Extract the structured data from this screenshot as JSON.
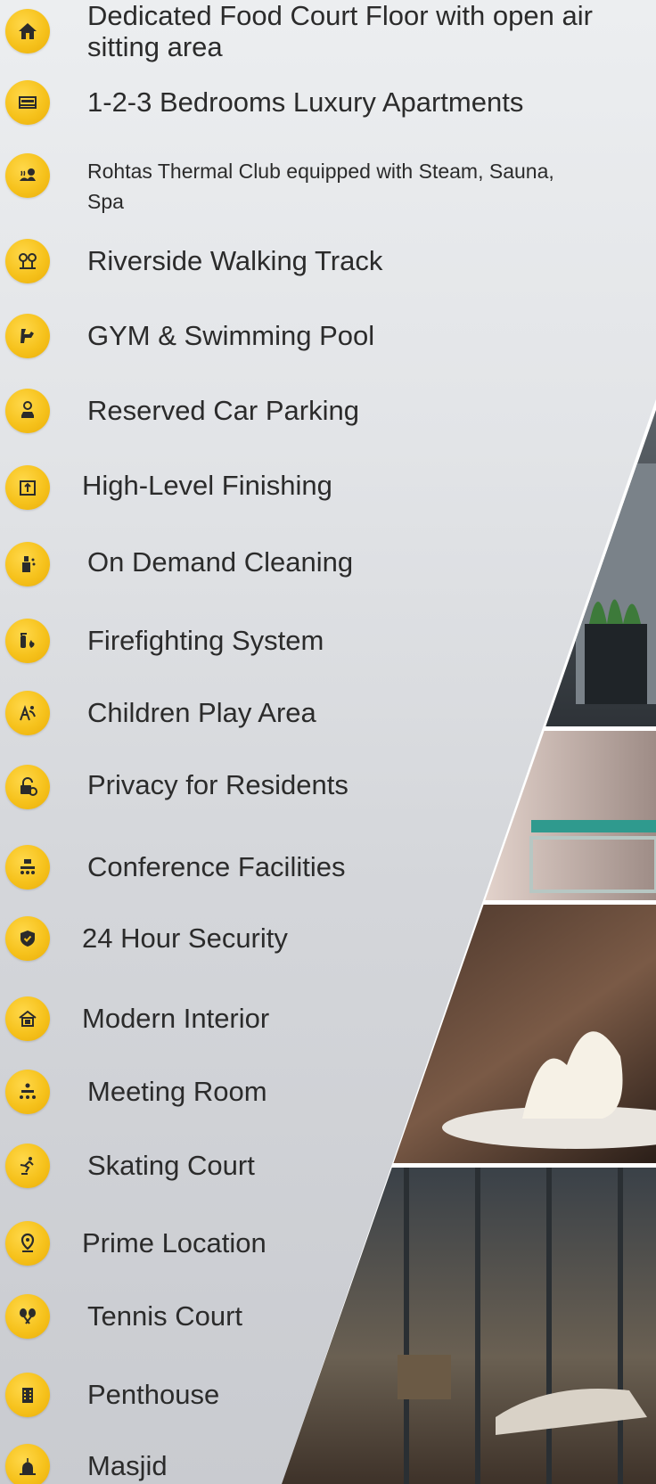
{
  "amenities": [
    {
      "label": "Dedicated Food Court Floor with open air sitting area",
      "icon": "home-icon"
    },
    {
      "label": "1-2-3 Bedrooms Luxury Apartments",
      "icon": "bed-icon"
    },
    {
      "label": "Rohtas Thermal Club equipped with Steam, Sauna, Spa",
      "icon": "spa-icon"
    },
    {
      "label": "Riverside Walking Track",
      "icon": "trees-icon"
    },
    {
      "label": "GYM & Swimming Pool",
      "icon": "gym-icon"
    },
    {
      "label": "Reserved Car Parking",
      "icon": "parking-icon"
    },
    {
      "label": "High-Level Finishing",
      "icon": "building-icon"
    },
    {
      "label": "On Demand Cleaning",
      "icon": "cleaning-icon"
    },
    {
      "label": "Firefighting System",
      "icon": "fire-extinguisher-icon"
    },
    {
      "label": "Children Play Area",
      "icon": "playground-icon"
    },
    {
      "label": "Privacy for Residents",
      "icon": "lock-icon"
    },
    {
      "label": "Conference Facilities",
      "icon": "conference-icon"
    },
    {
      "label": "24 Hour Security",
      "icon": "shield-icon"
    },
    {
      "label": "Modern Interior",
      "icon": "house-icon"
    },
    {
      "label": "Meeting Room",
      "icon": "meeting-icon"
    },
    {
      "label": "Skating Court",
      "icon": "skating-icon"
    },
    {
      "label": "Prime Location",
      "icon": "location-pin-icon"
    },
    {
      "label": "Tennis Court",
      "icon": "tennis-icon"
    },
    {
      "label": "Penthouse",
      "icon": "tower-icon"
    },
    {
      "label": "Masjid",
      "icon": "mosque-icon"
    }
  ],
  "colors": {
    "badge": "#f6c21c",
    "icon": "#2b2b2b",
    "text": "#2b2b2b"
  }
}
